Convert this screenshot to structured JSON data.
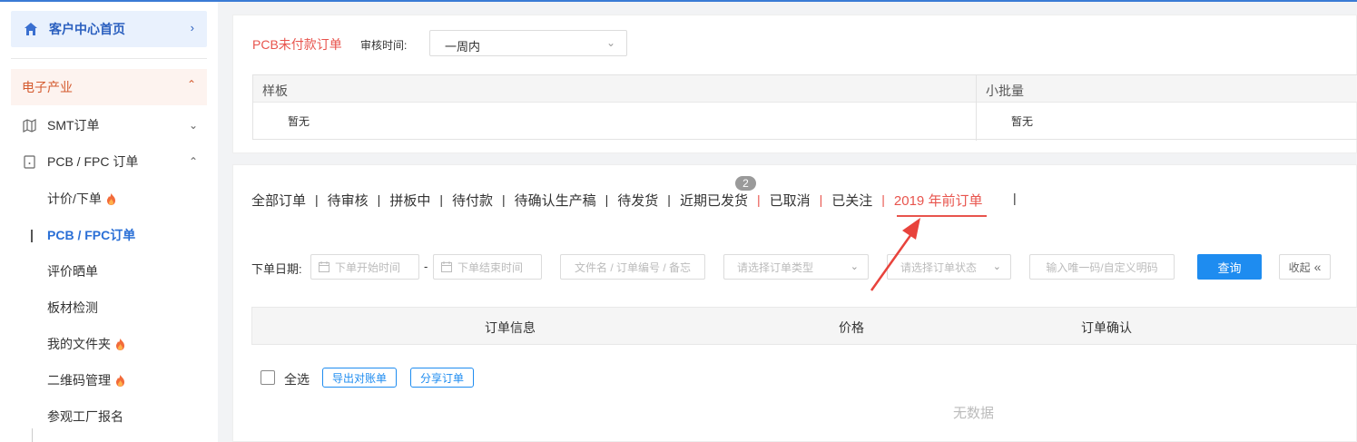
{
  "sidebar": {
    "home_label": "客户中心首页",
    "section_label": "电子产业",
    "smt_label": "SMT订单",
    "pcb_label": "PCB / FPC 订单",
    "sub_items": {
      "quote": "计价/下单",
      "pcb_orders": "PCB / FPC订单",
      "review": "评价晒单",
      "board_test": "板材检测",
      "my_folder": "我的文件夹",
      "qrcode": "二维码管理",
      "factory_visit": "参观工厂报名"
    }
  },
  "unpaid": {
    "title": "PCB未付款订单",
    "review_time_label": "审核时间:",
    "review_time_value": "一周内",
    "col_sample": "样板",
    "col_batch": "小批量",
    "sample_value": "暂无",
    "batch_value": "暂无"
  },
  "orders": {
    "tabs": {
      "all": "全部订单",
      "pending_review": "待审核",
      "panelizing": "拼板中",
      "pending_payment": "待付款",
      "confirm_production": "待确认生产稿",
      "pending_ship": "待发货",
      "recent_shipped": "近期已发货",
      "cancelled": "已取消",
      "followed": "已关注",
      "before_2019": "2019 年前订单"
    },
    "recent_shipped_badge": "2",
    "separator": "|",
    "filters": {
      "date_label": "下单日期:",
      "start_placeholder": "下单开始时间",
      "date_separator": "-",
      "end_placeholder": "下单结束时间",
      "keyword_placeholder": "文件名 / 订单编号 / 备忘",
      "type_placeholder": "请选择订单类型",
      "status_placeholder": "请选择订单状态",
      "code_placeholder": "输入唯一码/自定义明码",
      "query_label": "查询",
      "collapse_label": "收起"
    },
    "table": {
      "col_info": "订单信息",
      "col_price": "价格",
      "col_confirm": "订单确认"
    },
    "select_all_label": "全选",
    "export_label": "导出对账单",
    "share_label": "分享订单",
    "empty_text": "无数据"
  },
  "colors": {
    "accent_blue": "#1e8cf0",
    "accent_red": "#e8544d",
    "sidebar_active": "#2a6fd6"
  }
}
